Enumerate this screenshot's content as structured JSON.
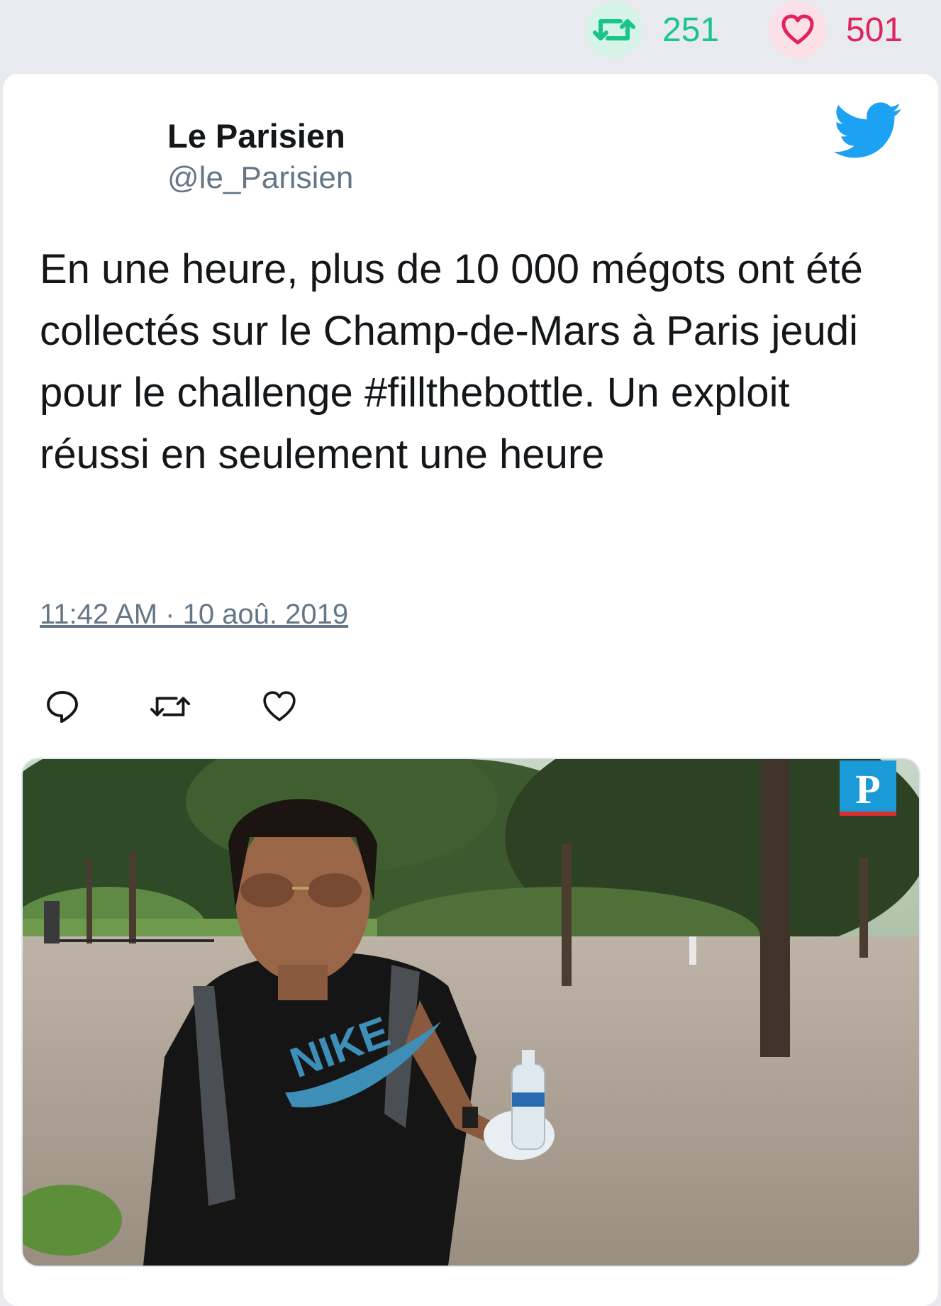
{
  "stats": {
    "retweet_count": "251",
    "like_count": "501"
  },
  "author": {
    "name": "Le Parisien",
    "handle": "@le_Parisien"
  },
  "tweet": {
    "text": "En une heure, plus de 10 000 mégots ont été collectés sur le Champ-de-Mars à Paris jeudi pour le challenge #fillthebottle. Un exploit réussi en seulement une heure",
    "timestamp": "11:42 AM · 10 aoû. 2019"
  },
  "media": {
    "logo_letter": "P",
    "shirt_text": "NIKE"
  },
  "colors": {
    "retweet": "#19c58a",
    "like": "#e0245e",
    "twitter_blue": "#1da1f2",
    "muted": "#657786"
  },
  "icons": {
    "retweet": "retweet-icon",
    "like": "heart-icon",
    "reply": "reply-icon",
    "brand": "twitter-bird-icon"
  }
}
